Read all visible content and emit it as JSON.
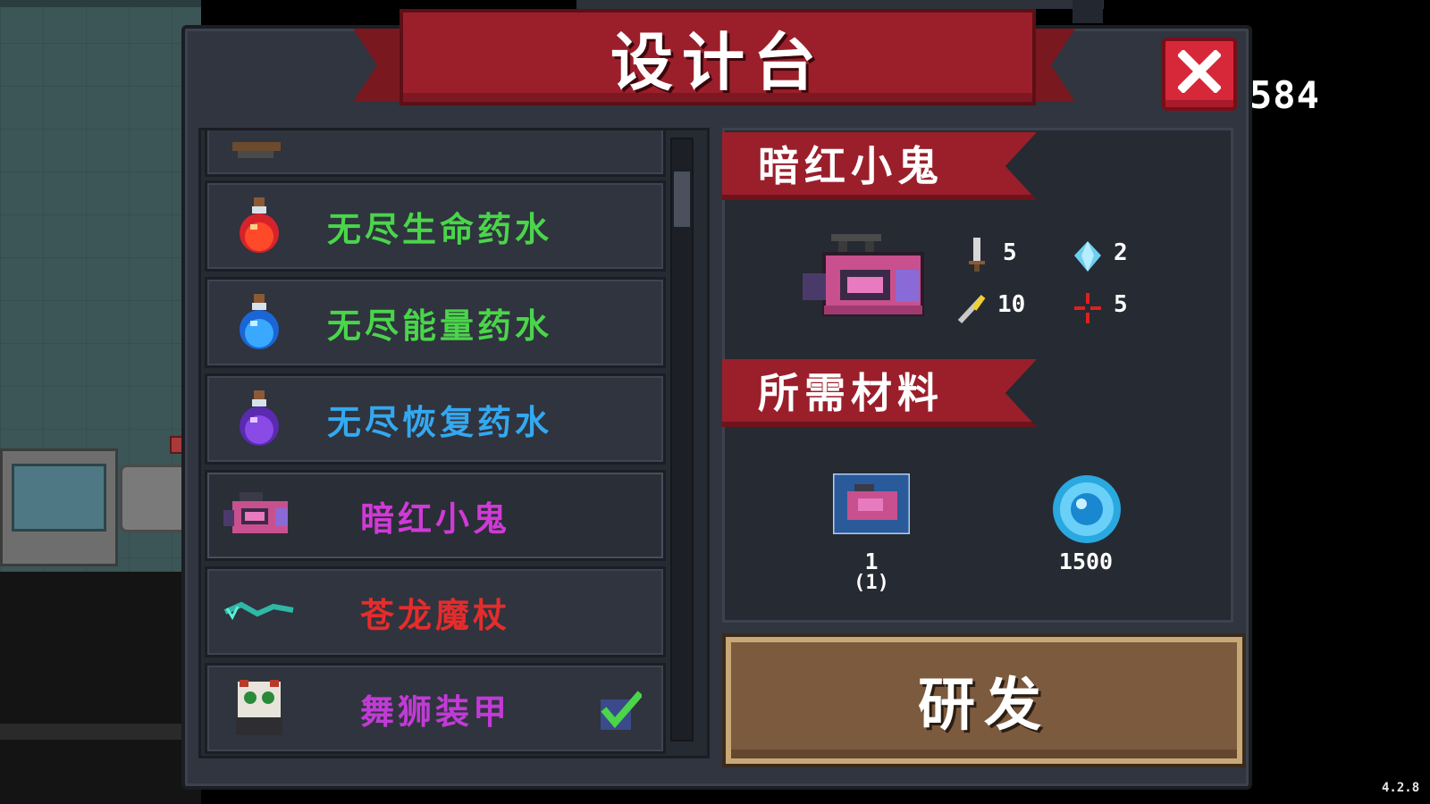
{
  "hud": {
    "corner_number": "584",
    "version": "4.2.8"
  },
  "dialog": {
    "title": "设计台",
    "close_label": "✕",
    "list": [
      {
        "label": "",
        "color": "#d8d8d8",
        "icon": "crossbow-icon"
      },
      {
        "label": "无尽生命药水",
        "color": "#4ad54a",
        "icon": "red-potion-icon"
      },
      {
        "label": "无尽能量药水",
        "color": "#4ad54a",
        "icon": "blue-potion-icon"
      },
      {
        "label": "无尽恢复药水",
        "color": "#34a8f0",
        "icon": "purple-potion-icon"
      },
      {
        "label": "暗红小鬼",
        "color": "#d03ad6",
        "icon": "pink-gun-icon"
      },
      {
        "label": "苍龙魔杖",
        "color": "#e52c2c",
        "icon": "dragon-staff-icon"
      },
      {
        "label": "舞狮装甲",
        "color": "#c23ad6",
        "icon": "lion-armor-icon",
        "owned": true
      }
    ],
    "detail": {
      "name": "暗红小鬼",
      "stats": [
        {
          "icon": "sword-icon",
          "value": "5"
        },
        {
          "icon": "diamond-icon",
          "value": "2"
        },
        {
          "icon": "bullet-icon",
          "value": "10"
        },
        {
          "icon": "crosshair-icon",
          "value": "5"
        }
      ],
      "materials_title": "所需材料",
      "materials": [
        {
          "icon": "blueprint-icon",
          "count": "1",
          "owned": "(1)"
        },
        {
          "icon": "gem-coin-icon",
          "count": "1500"
        }
      ],
      "research_label": "研发"
    }
  }
}
